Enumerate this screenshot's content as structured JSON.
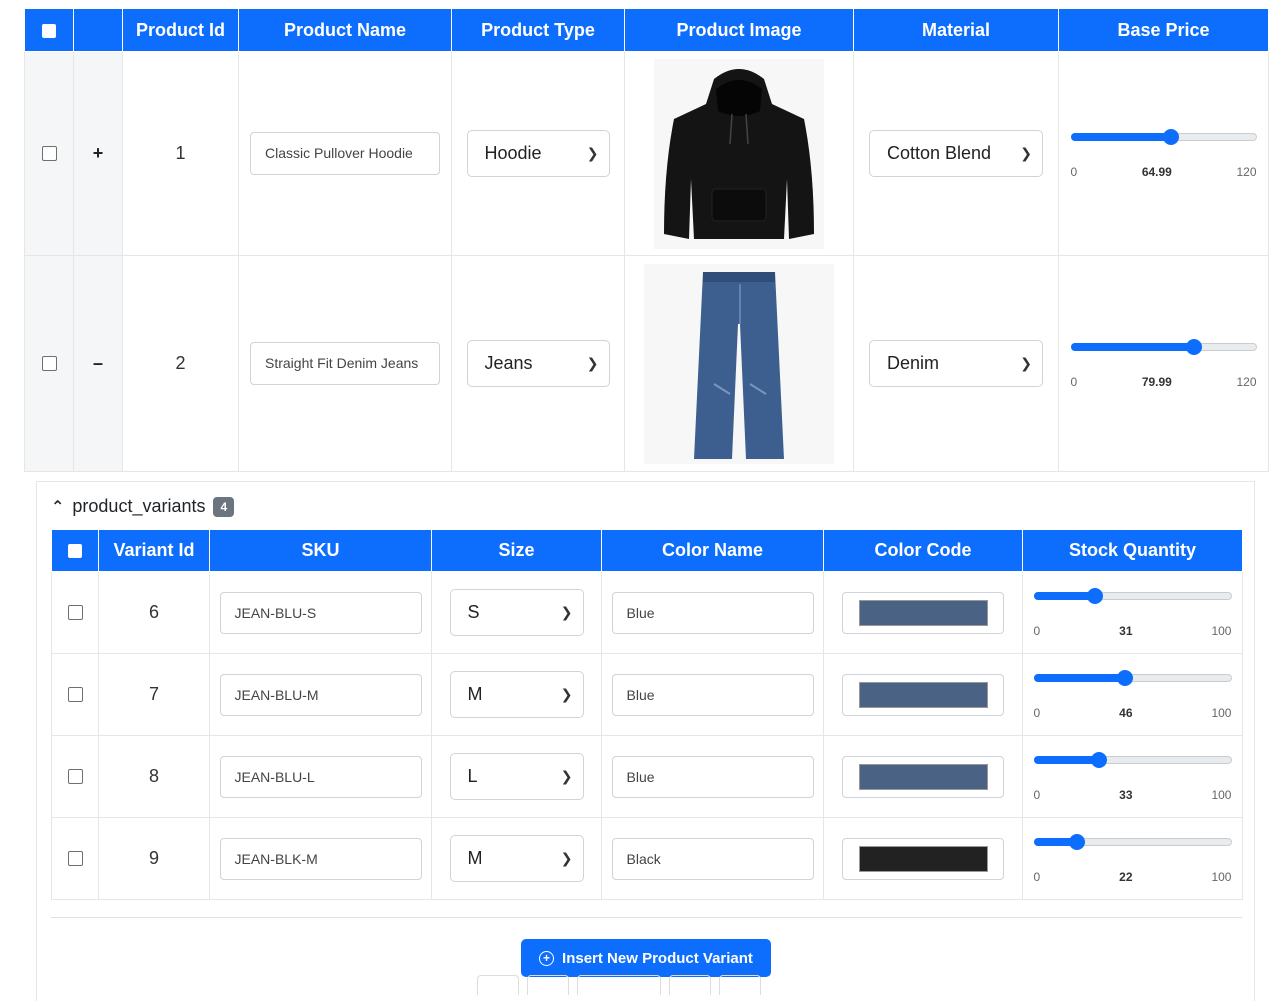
{
  "headers": [
    "Product Id",
    "Product Name",
    "Product Type",
    "Product Image",
    "Material",
    "Base Price"
  ],
  "products": [
    {
      "id": "1",
      "expand": "+",
      "name": "Classic Pullover Hoodie",
      "type": "Hoodie",
      "image": "black-hoodie",
      "material": "Cotton Blend",
      "price": {
        "min": "0",
        "value": "64.99",
        "max": "120",
        "fraction": 0.5416
      }
    },
    {
      "id": "2",
      "expand": "–",
      "name": "Straight Fit Denim Jeans",
      "type": "Jeans",
      "image": "blue-jeans",
      "material": "Denim",
      "price": {
        "min": "0",
        "value": "79.99",
        "max": "120",
        "fraction": 0.6666
      }
    }
  ],
  "variants_section": {
    "title": "product_variants",
    "count": "4",
    "headers": [
      "Variant Id",
      "SKU",
      "Size",
      "Color Name",
      "Color Code",
      "Stock Quantity"
    ],
    "rows": [
      {
        "id": "6",
        "sku": "JEAN-BLU-S",
        "size": "S",
        "color_name": "Blue",
        "color_code": "#4a6283",
        "stock": {
          "min": "0",
          "value": "31",
          "max": "100",
          "fraction": 0.31
        }
      },
      {
        "id": "7",
        "sku": "JEAN-BLU-M",
        "size": "M",
        "color_name": "Blue",
        "color_code": "#4a6283",
        "stock": {
          "min": "0",
          "value": "46",
          "max": "100",
          "fraction": 0.46
        }
      },
      {
        "id": "8",
        "sku": "JEAN-BLU-L",
        "size": "L",
        "color_name": "Blue",
        "color_code": "#4a6283",
        "stock": {
          "min": "0",
          "value": "33",
          "max": "100",
          "fraction": 0.33
        }
      },
      {
        "id": "9",
        "sku": "JEAN-BLK-M",
        "size": "M",
        "color_name": "Black",
        "color_code": "#222222",
        "stock": {
          "min": "0",
          "value": "22",
          "max": "100",
          "fraction": 0.22
        }
      }
    ],
    "insert_button": "Insert New Product Variant"
  },
  "colors": {
    "accent": "#0d6efd",
    "badge": "#6c757d"
  },
  "icons": {
    "collapse": "chevron-up-icon",
    "insert": "plus-circle-icon",
    "dropdown": "chevron-down-icon"
  }
}
